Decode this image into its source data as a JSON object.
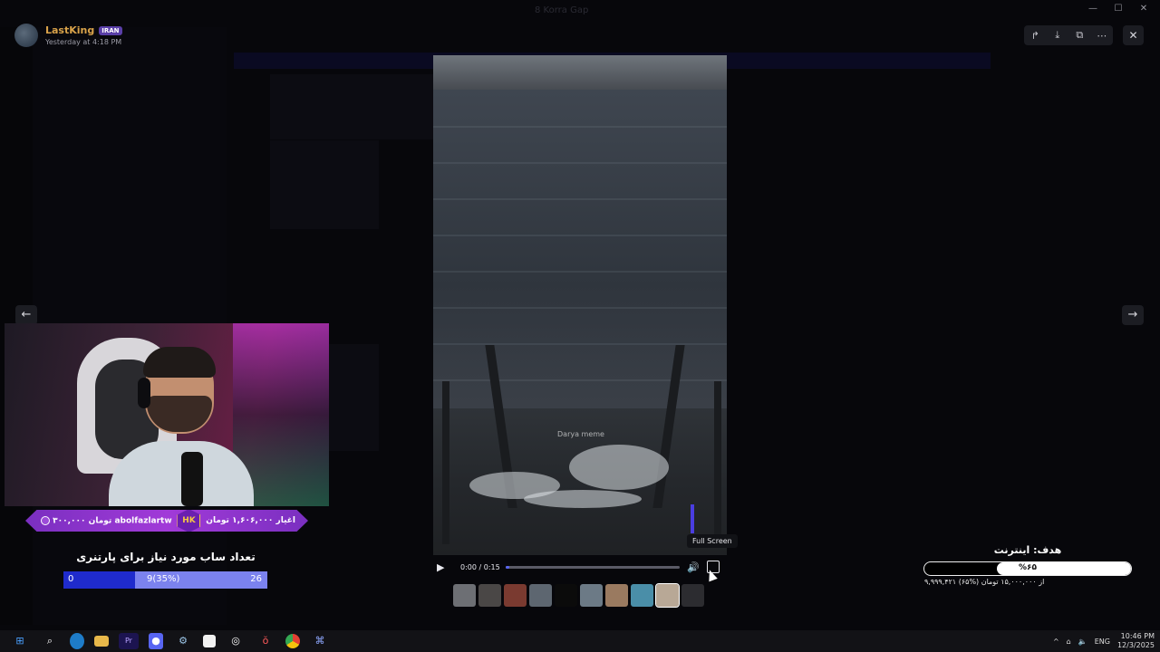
{
  "window": {
    "title": "8 Korra Gap",
    "controls": [
      "—",
      "☐",
      "✕"
    ]
  },
  "author": {
    "name": "LastKing",
    "badge": "IRAN",
    "timestamp": "Yesterday at 4:18 PM"
  },
  "viewer_toolbar": {
    "icons": [
      "forward-icon",
      "download-icon",
      "open-external-icon",
      "more-icon"
    ]
  },
  "close": {
    "icon": "✕"
  },
  "nav": {
    "prev": "←",
    "next": "→"
  },
  "video": {
    "watermark": "Darya meme",
    "current_time": "0:00",
    "duration": "0:15",
    "time_display": "0:00 / 0:15",
    "progress_fraction": 0.02,
    "fullscreen_tooltip": "Full Screen"
  },
  "thumbnails": [
    "#6d6f74",
    "#4a4746",
    "#7a3a30",
    "#5d6670",
    "#0b0b0b",
    "#6c7a86",
    "#9a7a60",
    "#4a8ea8",
    "#b8a896",
    "#2c2c30"
  ],
  "stream_overlay": {
    "donation_left_amount": "۳۰۰,۰۰۰ تومان",
    "donation_left_user": "abolfazlartw",
    "donation_badge": "HK",
    "donation_right_text": "اغیار ۱,۶۰۶,۰۰۰ تومان",
    "sub_title": "تعداد ساب مورد نیاز برای پارتنری",
    "sub_start": "0",
    "sub_current": "9(35%)",
    "sub_target": "26",
    "sub_fraction": 0.35,
    "goal_title": "هدف: اینترنت",
    "goal_percent": "%۶۵",
    "goal_fraction": 0.65,
    "goal_sub": "۹,۹۹۹,۴۲۱ از ۱۵,۰۰۰,۰۰۰ تومان (%۶۵)"
  },
  "taskbar": {
    "icons": [
      "windows-start-icon",
      "search-icon",
      "edge-icon",
      "file-explorer-icon",
      "premiere-icon",
      "discord-icon",
      "steam-icon",
      "store-icon",
      "obs-icon",
      "app-icon",
      "chrome-icon",
      "app2-icon"
    ],
    "lang": "ENG",
    "time": "10:46 PM",
    "date": "12/3/2025"
  }
}
